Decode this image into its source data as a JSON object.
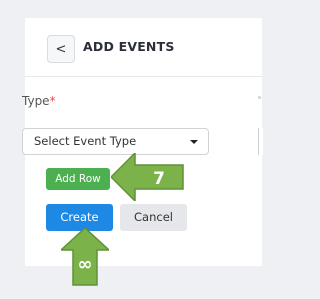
{
  "header": {
    "back_icon": "chevron-left-icon",
    "back_glyph": "<",
    "title": "ADD EVENTS"
  },
  "form": {
    "type_label": "Type",
    "required_mark": "*",
    "select_value": "Select Event Type"
  },
  "buttons": {
    "add_row": "Add Row",
    "create": "Create",
    "cancel": "Cancel"
  },
  "annotations": {
    "left_arrow_label": "7",
    "up_arrow_label": "∞",
    "arrow_color": "#7bb34a"
  }
}
